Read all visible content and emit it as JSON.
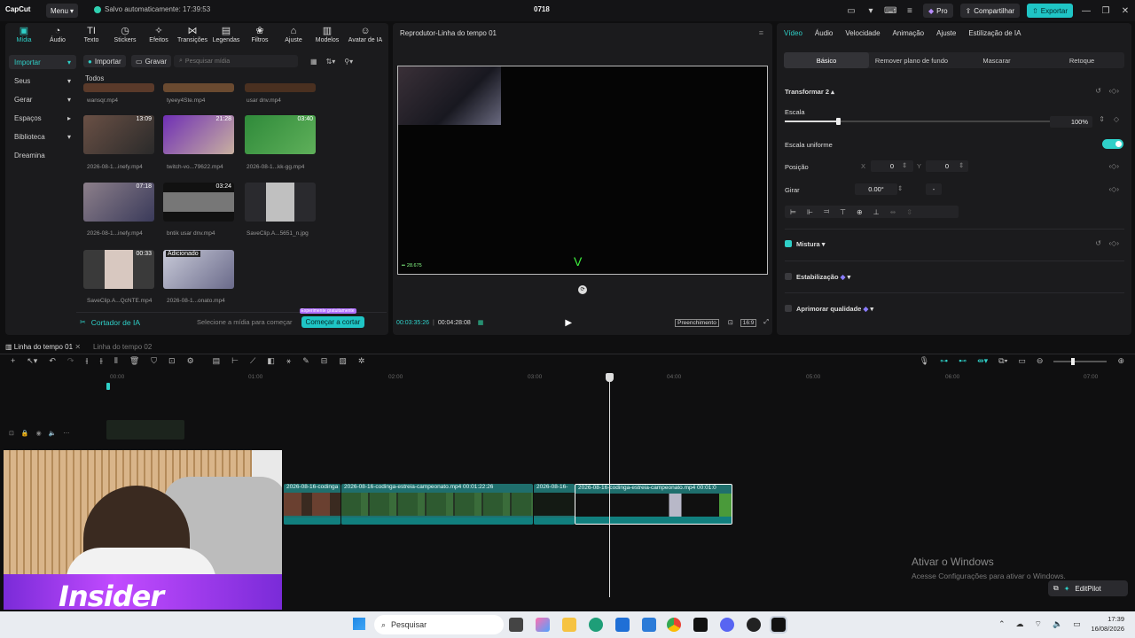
{
  "titlebar": {
    "logo": "CapCut",
    "menu_label": "Menu",
    "autosave": "Salvo automaticamente: 17:39:53",
    "project_title": "0718",
    "pro_label": "Pro",
    "share_label": "Compartilhar",
    "export_label": "Exportar"
  },
  "toolbar": {
    "tools": [
      "Mídia",
      "Áudio",
      "Texto",
      "Stickers",
      "Efeitos",
      "Transições",
      "Legendas",
      "Filtros",
      "Ajuste",
      "Modelos",
      "Avatar de IA"
    ]
  },
  "media": {
    "sidenav": [
      "Importar",
      "Seus",
      "Gerar",
      "Espaços",
      "Biblioteca",
      "Dreamina"
    ],
    "import_label": "Importar",
    "record_label": "Gravar",
    "search_placeholder": "Pesquisar mídia",
    "section_label": "Todos",
    "items": [
      {
        "name": "wansqr.mp4",
        "duration": ""
      },
      {
        "name": "tyeey4Ste.mp4",
        "duration": ""
      },
      {
        "name": "usar dnv.mp4",
        "duration": ""
      },
      {
        "name": "2026-08-1...inefy.mp4",
        "duration": "13:09"
      },
      {
        "name": "twitch-vo...79622.mp4",
        "duration": "21:28"
      },
      {
        "name": "2026-08-1...kk-gg.mp4",
        "duration": "03:40"
      },
      {
        "name": "2026-08-1...inefy.mp4",
        "duration": "07:18"
      },
      {
        "name": "bntik usar dnv.mp4",
        "duration": "03:24"
      },
      {
        "name": "SaveClip.A...5651_n.jpg",
        "duration": ""
      },
      {
        "name": "SaveClip.A...QcNTE.mp4",
        "duration": "00:33"
      },
      {
        "name": "2026-08-1...onato.mp4",
        "duration": "",
        "badge": "Adicionado"
      }
    ],
    "cutter_label": "Cortador de IA",
    "cutter_hint": "Selecione a mídia para começar",
    "cutter_cta": "Começar a cortar",
    "cutter_badge": "Experimente gratuitamente"
  },
  "player": {
    "title": "Reprodutor-Linha do tempo 01",
    "current_time": "00:03:35:26",
    "total_time": "00:04:28:08",
    "fill_label": "Preenchimento",
    "ratio_label": "16:9",
    "overlay_counter": "28.675"
  },
  "props": {
    "tabs": [
      "Vídeo",
      "Áudio",
      "Velocidade",
      "Animação",
      "Ajuste",
      "Estilização de IA"
    ],
    "subtabs": [
      "Básico",
      "Remover plano de fundo",
      "Mascarar",
      "Retoque"
    ],
    "transform_label": "Transformar 2",
    "scale_label": "Escala",
    "scale_value": "100%",
    "scale_level": 1.0,
    "uniform_label": "Escala uniforme",
    "position_label": "Posição",
    "x_label": "X",
    "x_value": "0",
    "y_label": "Y",
    "y_value": "0",
    "rotate_label": "Girar",
    "rotate_value": "0.00°",
    "rotate_dash": "-",
    "blend_label": "Mistura",
    "stabilize_label": "Estabilização",
    "enhance_label": "Aprimorar qualidade"
  },
  "timeline": {
    "tabs": [
      "Linha do tempo 01",
      "Linha do tempo 02"
    ],
    "ruler": [
      "00:00",
      "01:00",
      "02:00",
      "03:00",
      "04:00",
      "05:00",
      "06:00",
      "07:00"
    ],
    "clips": [
      {
        "label": "2026-08-16-codinga"
      },
      {
        "label": "2026-08-16-codinga-estreia-campeonato.mp4   00:01:22:26"
      },
      {
        "label": "2026-08-16-"
      },
      {
        "label": "2026-08-16-codinga-estreia-campeonato.mp4   00:01:0"
      }
    ]
  },
  "watermark": {
    "title": "Ativar o Windows",
    "subtitle": "Acesse Configurações para ativar o Windows."
  },
  "editpilot_label": "EditPilot",
  "webcam_brand": "Insider",
  "taskbar": {
    "search_placeholder": "Pesquisar",
    "time": "17:39",
    "date": "16/08/2026"
  },
  "colors": {
    "accent": "#2fd0c8",
    "export": "#1fc5c5",
    "clip": "#1f6f6d"
  }
}
